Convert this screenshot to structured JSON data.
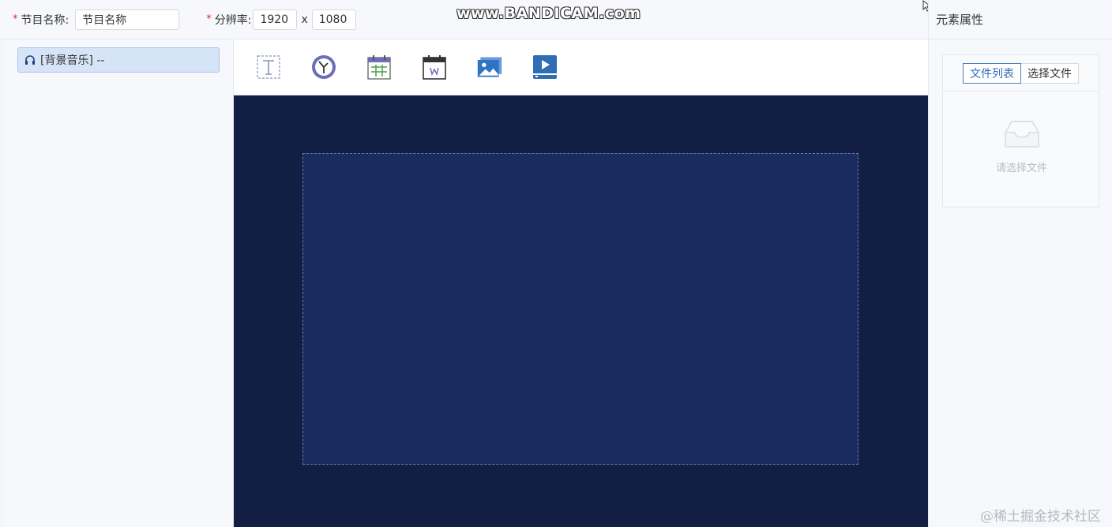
{
  "header": {
    "program_name_label": "节目名称:",
    "program_name_value": "节目名称",
    "resolution_label": "分辨率:",
    "resolution_width": "1920",
    "resolution_separator": "x",
    "resolution_height": "1080",
    "required_mark": "*"
  },
  "recorder_watermark": "www.BANDICAM.com",
  "layers": [
    {
      "label": "[背景音乐] --",
      "icon": "headphones-icon"
    }
  ],
  "toolbar": {
    "tools": [
      {
        "name": "text-tool",
        "icon": "text-box-icon"
      },
      {
        "name": "clock-tool",
        "icon": "clock-icon"
      },
      {
        "name": "date-tool",
        "icon": "calendar-icon"
      },
      {
        "name": "week-tool",
        "icon": "weekday-calendar-icon"
      },
      {
        "name": "image-tool",
        "icon": "image-icon"
      },
      {
        "name": "video-tool",
        "icon": "video-icon"
      }
    ]
  },
  "properties": {
    "title": "元素属性",
    "tabs": [
      {
        "label": "文件列表",
        "active": true
      },
      {
        "label": "选择文件",
        "active": false
      }
    ],
    "empty_text": "请选择文件"
  },
  "site_watermark": "@稀土掘金技术社区",
  "colors": {
    "canvas_bg": "#121e44",
    "stage_bg": "#1a2b60",
    "active_tab": "#2f6db5",
    "required": "#f5222d"
  }
}
